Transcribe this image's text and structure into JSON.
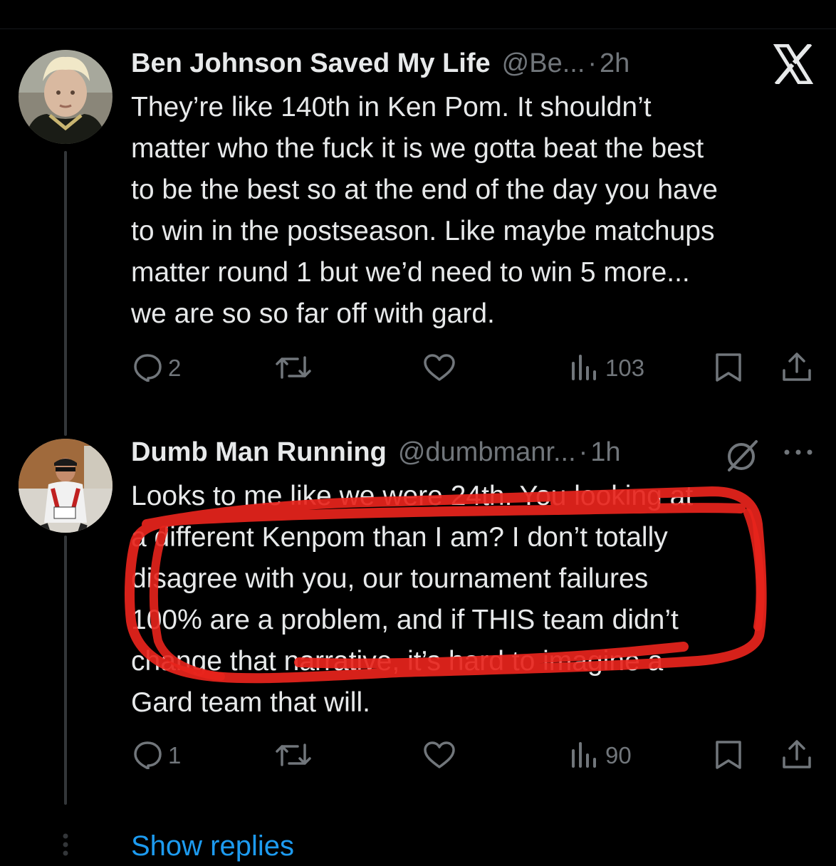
{
  "colors": {
    "background": "#000000",
    "text_primary": "#e7e9ea",
    "text_secondary": "#71767b",
    "accent_link": "#1d9bf0",
    "annotation_red": "#e8241c"
  },
  "tweets": [
    {
      "display_name": "Ben Johnson Saved My Life",
      "handle": "@Be...",
      "separator": "·",
      "time": "2h",
      "avatar_icon": "avatar-portrait",
      "corner_icon": "x-logo-icon",
      "text_lines": [
        "They’re like 140th in Ken Pom. It shouldn’t",
        "matter who the fuck it is we gotta beat the best",
        "to be the best so at the end of the day you have",
        "to win in the postseason. Like maybe matchups",
        "matter round 1 but we’d need to win 5 more...",
        "we are so so far off with gard."
      ],
      "actions": {
        "replies": "2",
        "retweets": "",
        "likes": "",
        "views": "103"
      }
    },
    {
      "display_name": "Dumb Man Running",
      "handle": "@dumbmanr...",
      "separator": "·",
      "time": "1h",
      "avatar_icon": "avatar-runner",
      "corner_icon": "grok-icon",
      "more_icon": "more-dots-icon",
      "text_lines": [
        "Looks to me like we were 24th. You looking at",
        "a different Kenpom than I am? I don’t totally",
        "disagree with you, our tournament failures",
        "100% are a problem, and if THIS team didn’t",
        "change that narrative, it’s hard to imagine a",
        "Gard team that will."
      ],
      "actions": {
        "replies": "1",
        "retweets": "",
        "likes": "",
        "views": "90"
      }
    }
  ],
  "show_replies_label": "Show replies"
}
